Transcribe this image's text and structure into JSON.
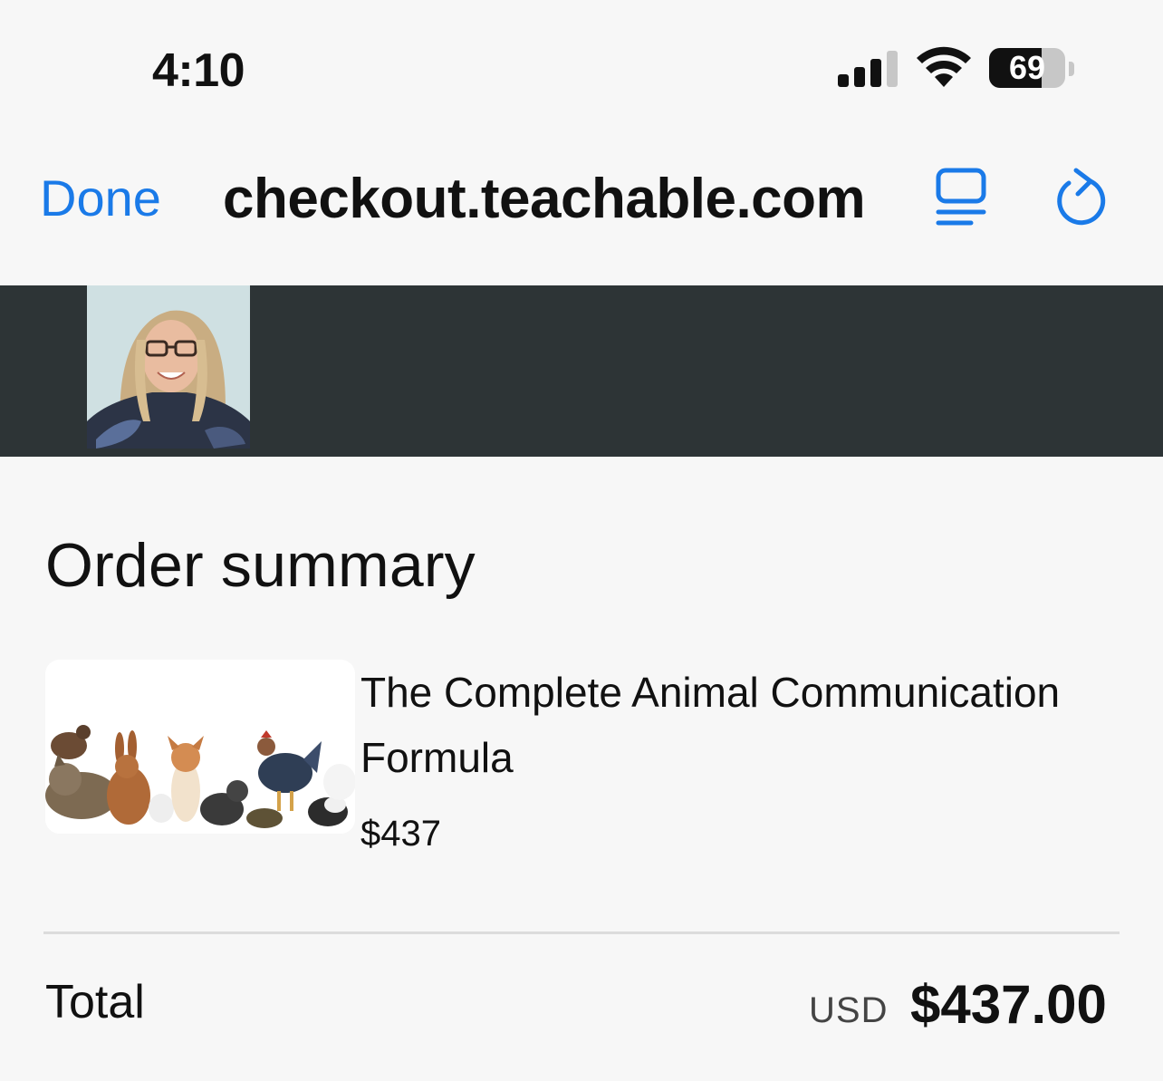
{
  "status_bar": {
    "time": "4:10",
    "battery_percent": "69",
    "battery_level": 0.69,
    "signal_icon": "cellular-signal-icon",
    "wifi_icon": "wifi-icon"
  },
  "browser": {
    "done_label": "Done",
    "url": "checkout.teachable.com",
    "reader_icon": "reader-mode-icon",
    "reload_icon": "reload-icon"
  },
  "header": {
    "avatar_icon": "instructor-avatar"
  },
  "order": {
    "title": "Order summary",
    "product": {
      "name": "The Complete Animal Communication Formula",
      "price": "$437"
    },
    "total_label": "Total",
    "total_currency": "USD",
    "total_amount": "$437.00"
  },
  "colors": {
    "accent": "#1a7ae8",
    "header_band": "#2d3436",
    "background": "#f7f7f7"
  }
}
